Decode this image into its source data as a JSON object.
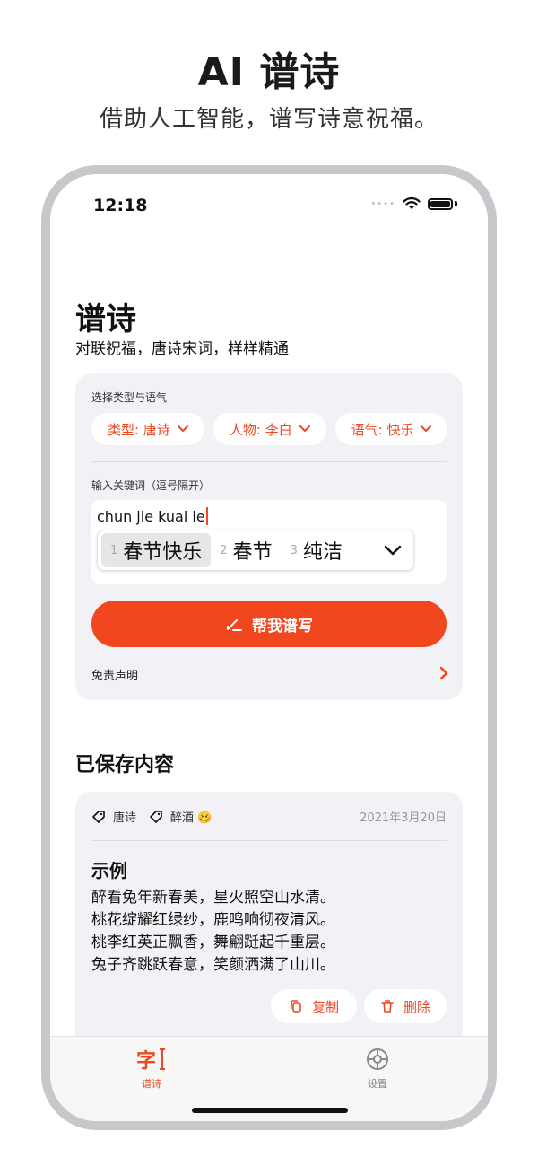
{
  "hero": {
    "title": "AI 谱诗",
    "subtitle": "借助人工智能，谱写诗意祝福。"
  },
  "status_bar": {
    "time": "12:18",
    "signal_dots": "••••",
    "wifi_icon": "wifi-icon",
    "battery_icon": "battery-icon"
  },
  "page": {
    "title": "谱诗",
    "subtitle": "对联祝福，唐诗宋词，样样精通"
  },
  "compose": {
    "type_section_label": "选择类型与语气",
    "chips": [
      {
        "label": "类型: 唐诗"
      },
      {
        "label": "人物: 李白"
      },
      {
        "label": "语气: 快乐"
      }
    ],
    "keyword_label": "输入关键词（逗号隔开）",
    "keyword_value": "chun jie kuai le",
    "ime_candidates": [
      {
        "num": "1",
        "text": "春节快乐",
        "selected": true
      },
      {
        "num": "2",
        "text": "春节",
        "selected": false
      },
      {
        "num": "3",
        "text": "纯洁",
        "selected": false
      }
    ],
    "submit_label": "帮我谱写",
    "disclaimer_label": "免责声明"
  },
  "saved": {
    "section_title": "已保存内容",
    "items": [
      {
        "tags": [
          "唐诗",
          "醉酒 🥴"
        ],
        "date": "2021年3月20日",
        "title": "示例",
        "lines": [
          "醉看兔年新春美，星火照空山水清。",
          "桃花绽耀红绿纱，鹿鸣响彻夜清风。",
          "桃李红英正飘香，舞翩跹起千重层。",
          "兔子齐跳跃春意，笑颜洒满了山川。"
        ],
        "copy_label": "复制",
        "delete_label": "删除"
      }
    ]
  },
  "tabbar": {
    "tabs": [
      {
        "label": "谱诗",
        "glyph": "字",
        "icon": "write-icon",
        "active": true
      },
      {
        "label": "设置",
        "icon": "gear-icon",
        "active": false
      }
    ]
  },
  "colors": {
    "accent": "#f0471f",
    "card_bg": "#f2f2f6",
    "frame": "#c8c8cc"
  }
}
